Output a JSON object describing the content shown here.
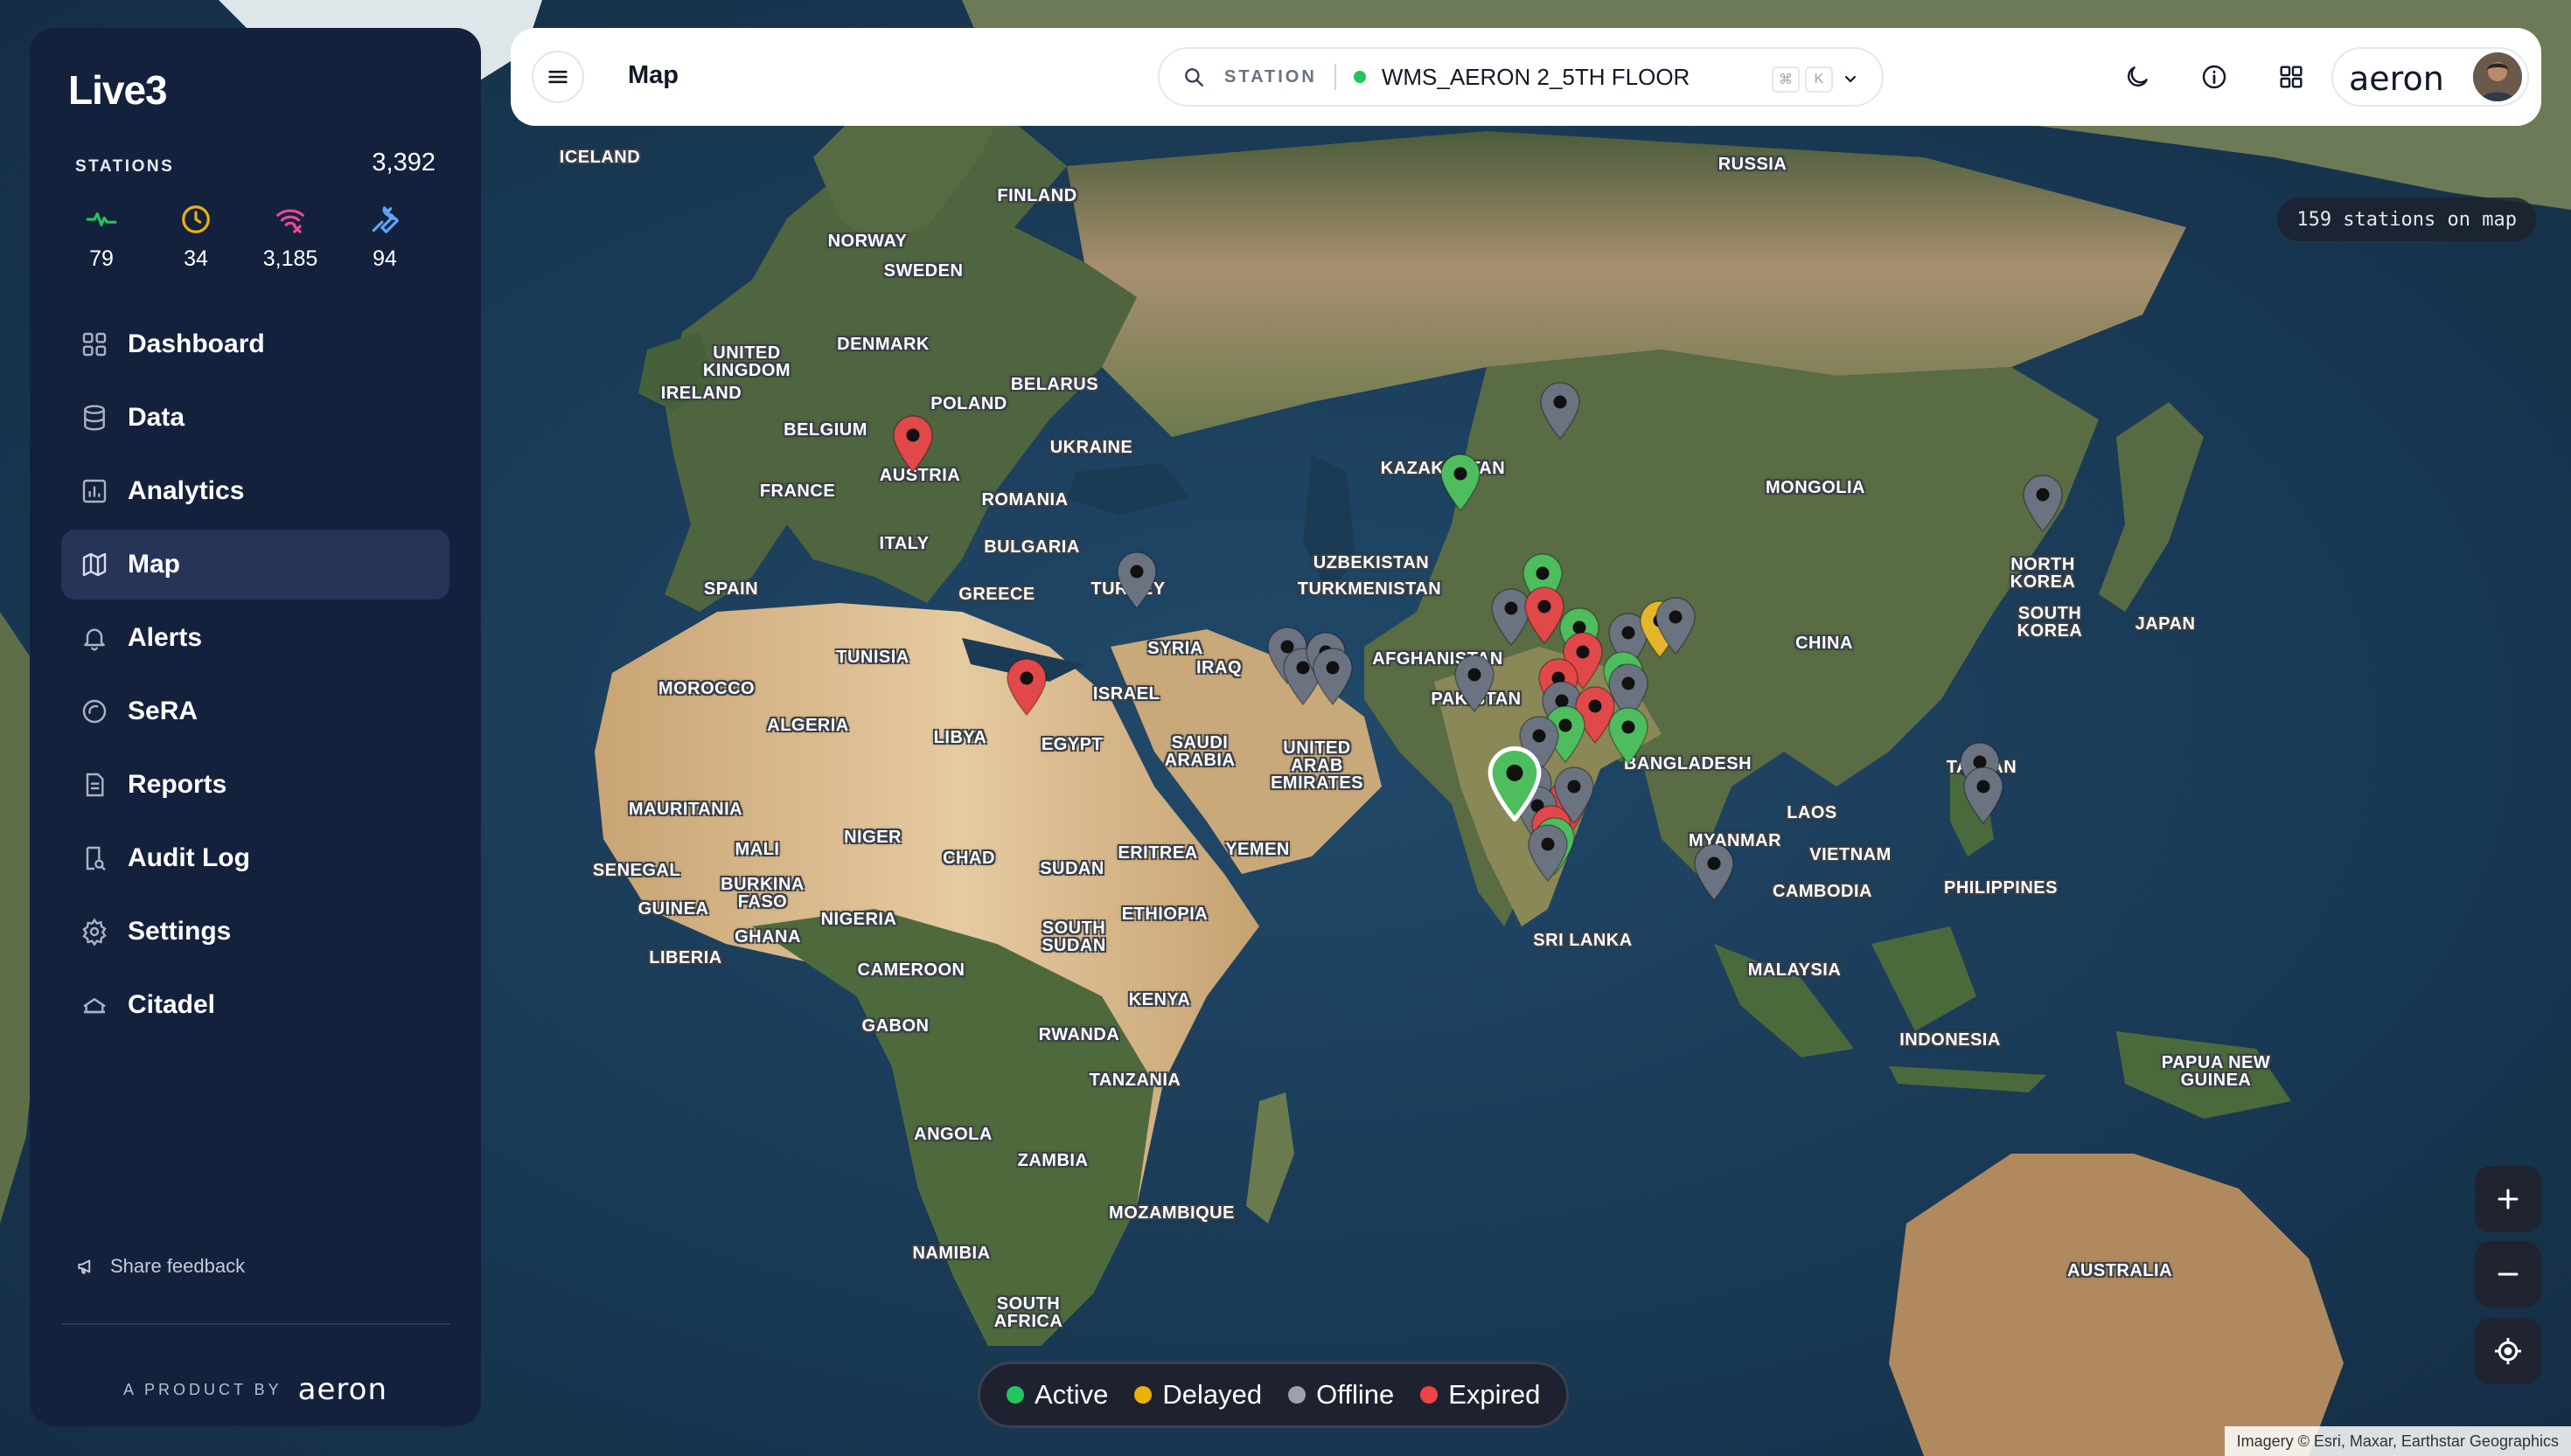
{
  "app": {
    "logo": "Live3",
    "brand": "aeron"
  },
  "sidebar": {
    "stations_title": "STATIONS",
    "stations_total": "3,392",
    "stats": [
      {
        "icon": "activity-icon",
        "value": "79",
        "color": "#22c55e"
      },
      {
        "icon": "clock-icon",
        "value": "34",
        "color": "#eab308"
      },
      {
        "icon": "wifi-off-icon",
        "value": "3,185",
        "color": "#ec4899"
      },
      {
        "icon": "wrench-icon",
        "value": "94",
        "color": "#60a5fa"
      }
    ],
    "nav": [
      {
        "label": "Dashboard",
        "icon": "grid-icon"
      },
      {
        "label": "Data",
        "icon": "database-icon"
      },
      {
        "label": "Analytics",
        "icon": "analytics-icon"
      },
      {
        "label": "Map",
        "icon": "map-icon",
        "active": true
      },
      {
        "label": "Alerts",
        "icon": "bell-icon"
      },
      {
        "label": "SeRA",
        "icon": "sera-icon"
      },
      {
        "label": "Reports",
        "icon": "report-icon"
      },
      {
        "label": "Audit Log",
        "icon": "audit-icon"
      },
      {
        "label": "Settings",
        "icon": "gear-icon"
      },
      {
        "label": "Citadel",
        "icon": "citadel-icon"
      }
    ],
    "feedback": "Share feedback",
    "product_by": "A PRODUCT BY",
    "product_brand": "aeron"
  },
  "topbar": {
    "title": "Map",
    "station_label": "STATION",
    "station_name": "WMS_AERON 2_5TH FLOOR",
    "kbd_cmd": "⌘",
    "kbd_k": "K",
    "brand": "aeron"
  },
  "map": {
    "station_count": "159 stations on map",
    "attribution": "Imagery © Esri, Maxar, Earthstar Geographics",
    "labels": [
      "ICELAND",
      "FINLAND",
      "RUSSIA",
      "NORWAY",
      "SWEDEN",
      "UNITED\nKINGDOM",
      "IRELAND",
      "DENMARK",
      "BELARUS",
      "POLAND",
      "BELGIUM",
      "UKRAINE",
      "FRANCE",
      "AUSTRIA",
      "ROMANIA",
      "KAZAKHSTAN",
      "MONGOLIA",
      "ITALY",
      "BULGARIA",
      "UZBEKISTAN",
      "SPAIN",
      "GREECE",
      "TURKEY",
      "TURKMENISTAN",
      "NORTH\nKOREA",
      "SOUTH\nKOREA",
      "JAPAN",
      "SYRIA",
      "IRAQ",
      "IRAN",
      "AFGHANISTAN",
      "CHINA",
      "MOROCCO",
      "TUNISIA",
      "ISRAEL",
      "PAKISTAN",
      "ALGERIA",
      "LIBYA",
      "EGYPT",
      "SAUDI\nARABIA",
      "UNITED\nARAB\nEMIRATES",
      "BANGLADESH",
      "TAIWAN",
      "MAURITANIA",
      "MYANMAR",
      "LAOS",
      "MALI",
      "NIGER",
      "CHAD",
      "ERITREA",
      "YEMEN",
      "VIETNAM",
      "SENEGAL",
      "BURKINA\nFASO",
      "GUINEA",
      "SUDAN",
      "CAMBODIA",
      "PHILIPPINES",
      "NIGERIA",
      "ETHIOPIA",
      "GHANA",
      "SOUTH\nSUDAN",
      "SRI LANKA",
      "LIBERIA",
      "CAMEROON",
      "MALAYSIA",
      "KENYA",
      "GABON",
      "RWANDA",
      "INDONESIA",
      "PAPUA NEW\nGUINEA",
      "TANZANIA",
      "ANGOLA",
      "ZAMBIA",
      "MOZAMBIQUE",
      "NAMIBIA",
      "AUSTRALIA",
      "SOUTH\nAFRICA"
    ],
    "status_colors": {
      "active": "#4ebd5e",
      "delayed": "#e5b52a",
      "offline": "#6b7280",
      "expired": "#e0484a"
    }
  },
  "legend": [
    {
      "label": "Active",
      "color": "#22c55e"
    },
    {
      "label": "Delayed",
      "color": "#eab308"
    },
    {
      "label": "Offline",
      "color": "#9ca3af"
    },
    {
      "label": "Expired",
      "color": "#ef4444"
    }
  ]
}
